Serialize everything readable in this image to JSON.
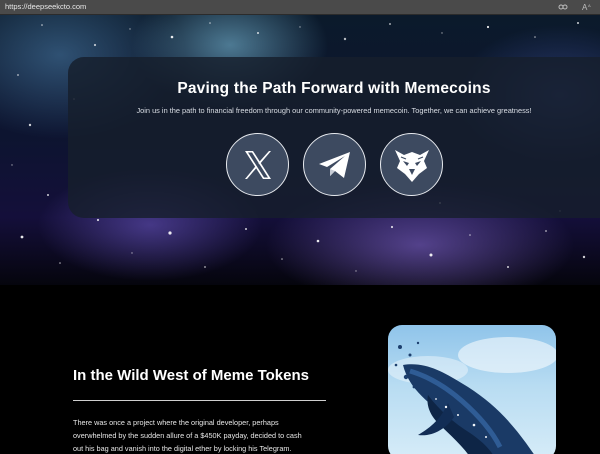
{
  "browser": {
    "url": "https://deepseekcto.com",
    "icons": [
      "reader-icon",
      "text-size-icon"
    ]
  },
  "hero": {
    "title": "Paving the Path Forward with Memecoins",
    "subtitle": "Join us in the path to financial freedom through our community-powered memecoin. Together, we can achieve greatness!",
    "socials": [
      {
        "name": "x-twitter-icon"
      },
      {
        "name": "telegram-icon"
      },
      {
        "name": "eagle-logo-icon"
      }
    ]
  },
  "story": {
    "title": "In the Wild West of Meme Tokens",
    "body_lines": [
      "There was once a project where the original developer, perhaps",
      "overwhelmed by the sudden allure of a $450K payday, decided to cash",
      "out his bag and vanish into the digital ether by locking his Telegram."
    ],
    "image": "whale-illustration"
  },
  "colors": {
    "card_bg": "#161e2c",
    "social_bg": "#3d4a60",
    "social_border": "#e6e9ee",
    "page_bg": "#000000"
  }
}
